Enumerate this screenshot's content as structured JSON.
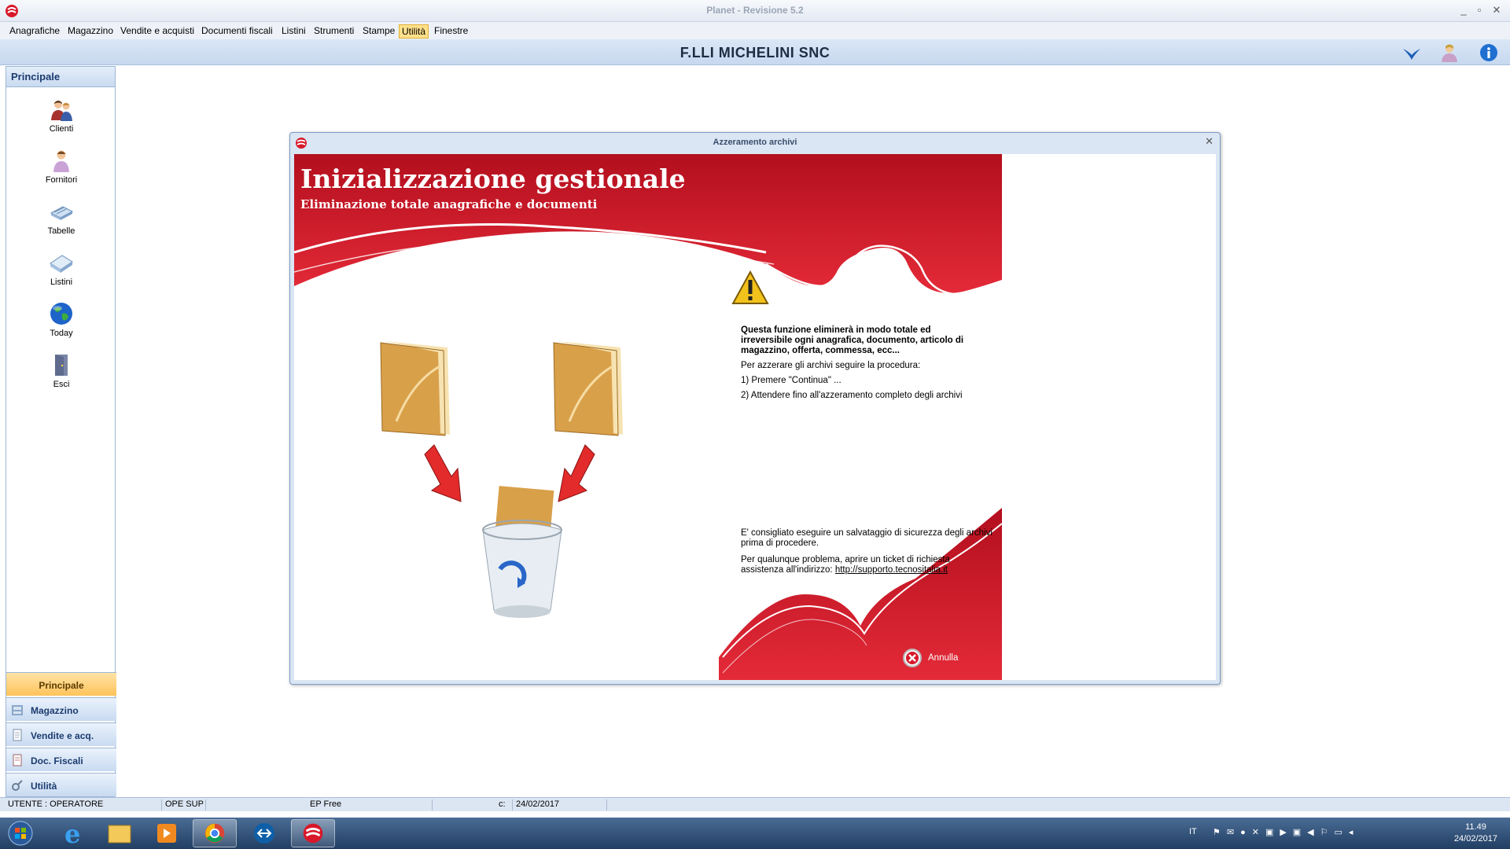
{
  "window": {
    "title": "Planet - Revisione 5.2"
  },
  "menu": [
    "Anagrafiche",
    "Magazzino",
    "Vendite e acquisti",
    "Documenti fiscali",
    "Listini",
    "Strumenti",
    "Stampe",
    "Utilità",
    "Finestre"
  ],
  "menu_active": "Utilità",
  "company": {
    "name": "F.LLI MICHELINI SNC"
  },
  "sidebar": {
    "header": "Principale",
    "items": [
      {
        "label": "Clienti",
        "icon": "clients-icon"
      },
      {
        "label": "Fornitori",
        "icon": "suppliers-icon"
      },
      {
        "label": "Tabelle",
        "icon": "tables-icon"
      },
      {
        "label": "Listini",
        "icon": "price-lists-icon"
      },
      {
        "label": "Today",
        "icon": "globe-icon"
      },
      {
        "label": "Esci",
        "icon": "exit-door-icon"
      }
    ],
    "groups": [
      {
        "label": "Principale",
        "selected": true
      },
      {
        "label": "Magazzino",
        "icon": "warehouse-icon"
      },
      {
        "label": "Vendite e acq.",
        "icon": "document-icon"
      },
      {
        "label": "Doc. Fiscali",
        "icon": "fiscal-doc-icon"
      },
      {
        "label": "Utilità",
        "icon": "tools-icon"
      }
    ]
  },
  "dialog": {
    "title": "Azzeramento archivi",
    "heading": "Inizializzazione gestionale",
    "subheading": "Eliminazione totale anagrafiche e documenti",
    "warning_bold": "Questa funzione eliminerà in modo totale ed irreversibile ogni anagrafica, documento, articolo di magazzino, offerta, commessa, ecc...",
    "procedure_intro": "Per azzerare gli archivi seguire la procedura:",
    "step1": "1) Premere \"Continua\" ...",
    "step2": "2) Attendere fino all'azzeramento completo degli archivi",
    "backup_note": "E' consigliato eseguire un salvataggio di sicurezza degli archivi prima di procedere.",
    "support_note": "Per qualunque problema, aprire un ticket di richiesta assistenza all'indirizzo:",
    "support_link": "http://supporto.tecnositalia.it",
    "cancel_label": "Annulla"
  },
  "statusbar": {
    "user": "UTENTE : OPERATORE",
    "role": "OPE SUP",
    "edition": "EP Free",
    "drive": "c:",
    "date": "24/02/2017"
  },
  "taskbar": {
    "lang": "IT",
    "time": "11.49",
    "date": "24/02/2017"
  },
  "colors": {
    "accent_red": "#d8182a",
    "selected_group": "#ffc35a",
    "nav_blue": "#c8daf1"
  }
}
